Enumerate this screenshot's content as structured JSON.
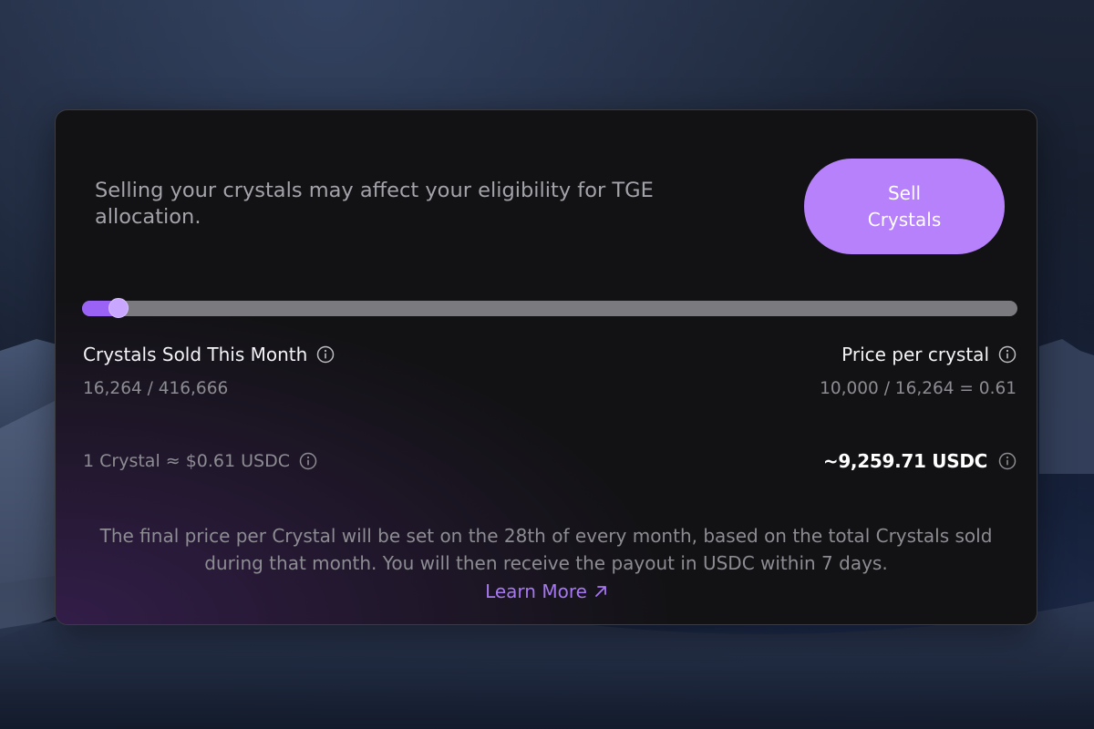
{
  "panel": {
    "warning_text": "Selling your crystals may affect your eligibility for TGE allocation.",
    "sell_button_label": "Sell Crystals"
  },
  "progress": {
    "sold": 16264,
    "total": 416666,
    "fraction": 0.039
  },
  "crystals_sold": {
    "title": "Crystals Sold This Month",
    "value": "16,264 / 416,666"
  },
  "price_per_crystal": {
    "title": "Price per crystal",
    "value": "10,000 / 16,264 = 0.61"
  },
  "conversion": {
    "rate_text": "1 Crystal ≈ $0.61 USDC",
    "total_text": "~9,259.71 USDC"
  },
  "footnote": {
    "text": "The final price per Crystal will be set on the 28th of every month, based on the total Crystals sold during that month. You will then receive the payout in USDC within 7 days.",
    "learn_more_label": "Learn More"
  },
  "icons": {
    "info": "info-circle-icon",
    "external": "arrow-up-right-icon"
  },
  "colors": {
    "accent": "#b681fb",
    "progress_fill": "#9b63f5",
    "link": "#a678f0",
    "card_bg": "#121214"
  }
}
